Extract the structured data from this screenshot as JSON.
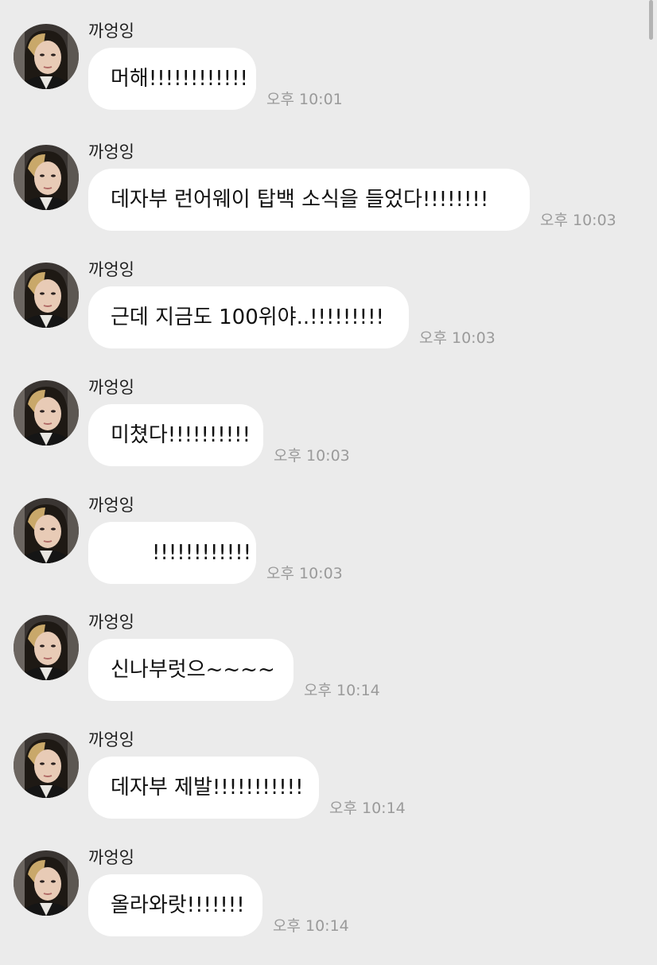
{
  "chat": {
    "messages": [
      {
        "sender": "까엉잉",
        "text": "머해!!!!!!!!!!!!",
        "time": "오후 10:01"
      },
      {
        "sender": "까엉잉",
        "text": "데자부 런어웨이 탑백 소식을 들었다!!!!!!!!",
        "time": "오후 10:03"
      },
      {
        "sender": "까엉잉",
        "text": "근데 지금도 100위야..!!!!!!!!!",
        "time": "오후 10:03"
      },
      {
        "sender": "까엉잉",
        "text": "미쳤다!!!!!!!!!!",
        "time": "오후 10:03"
      },
      {
        "sender": "까엉잉",
        "text": "!!!!!!!!!!!!",
        "time": "오후 10:03"
      },
      {
        "sender": "까엉잉",
        "text": "신나부럿으~~~~",
        "time": "오후 10:14"
      },
      {
        "sender": "까엉잉",
        "text": "데자부 제발!!!!!!!!!!!",
        "time": "오후 10:14"
      },
      {
        "sender": "까엉잉",
        "text": "올라와랏!!!!!!!",
        "time": "오후 10:14"
      }
    ]
  },
  "colors": {
    "background": "#ebebeb",
    "bubble": "#ffffff",
    "timestamp": "#9a9a9a"
  },
  "icons": {
    "avatar": "profile-photo"
  }
}
